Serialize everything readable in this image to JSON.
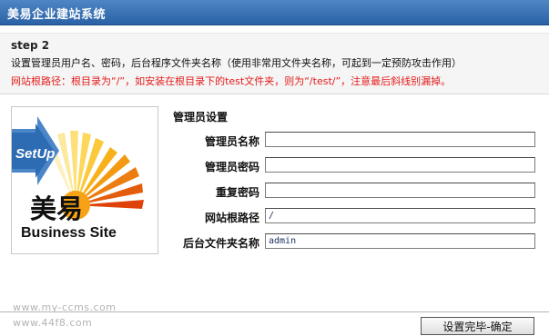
{
  "window": {
    "title": "美易企业建站系统"
  },
  "info": {
    "step": "step 2",
    "description": "设置管理员用户名、密码，后台程序文件夹名称（使用非常用文件夹名称，可起到一定预防攻击作用）",
    "warning": "网站根路径：根目录为“/”，如安装在根目录下的test文件夹，则为“/test/”，注意最后斜线别漏掉。"
  },
  "logo": {
    "setup_text": "SetUp",
    "brand_cn": "美易",
    "brand_en": "Business Site"
  },
  "form": {
    "section_title": "管理员设置",
    "fields": [
      {
        "label": "管理员名称",
        "value": ""
      },
      {
        "label": "管理员密码",
        "value": ""
      },
      {
        "label": "重复密码",
        "value": ""
      },
      {
        "label": "网站根路径",
        "value": "/"
      },
      {
        "label": "后台文件夹名称",
        "value": "admin"
      }
    ]
  },
  "footer": {
    "watermarks": [
      "www.my-ccms.com",
      "www.44f8.com"
    ],
    "submit_label": "设置完毕-确定"
  },
  "colors": {
    "title_bar": "#3a72b5",
    "warning_text": "#e31c1c",
    "info_bg": "#f5f5f5"
  }
}
